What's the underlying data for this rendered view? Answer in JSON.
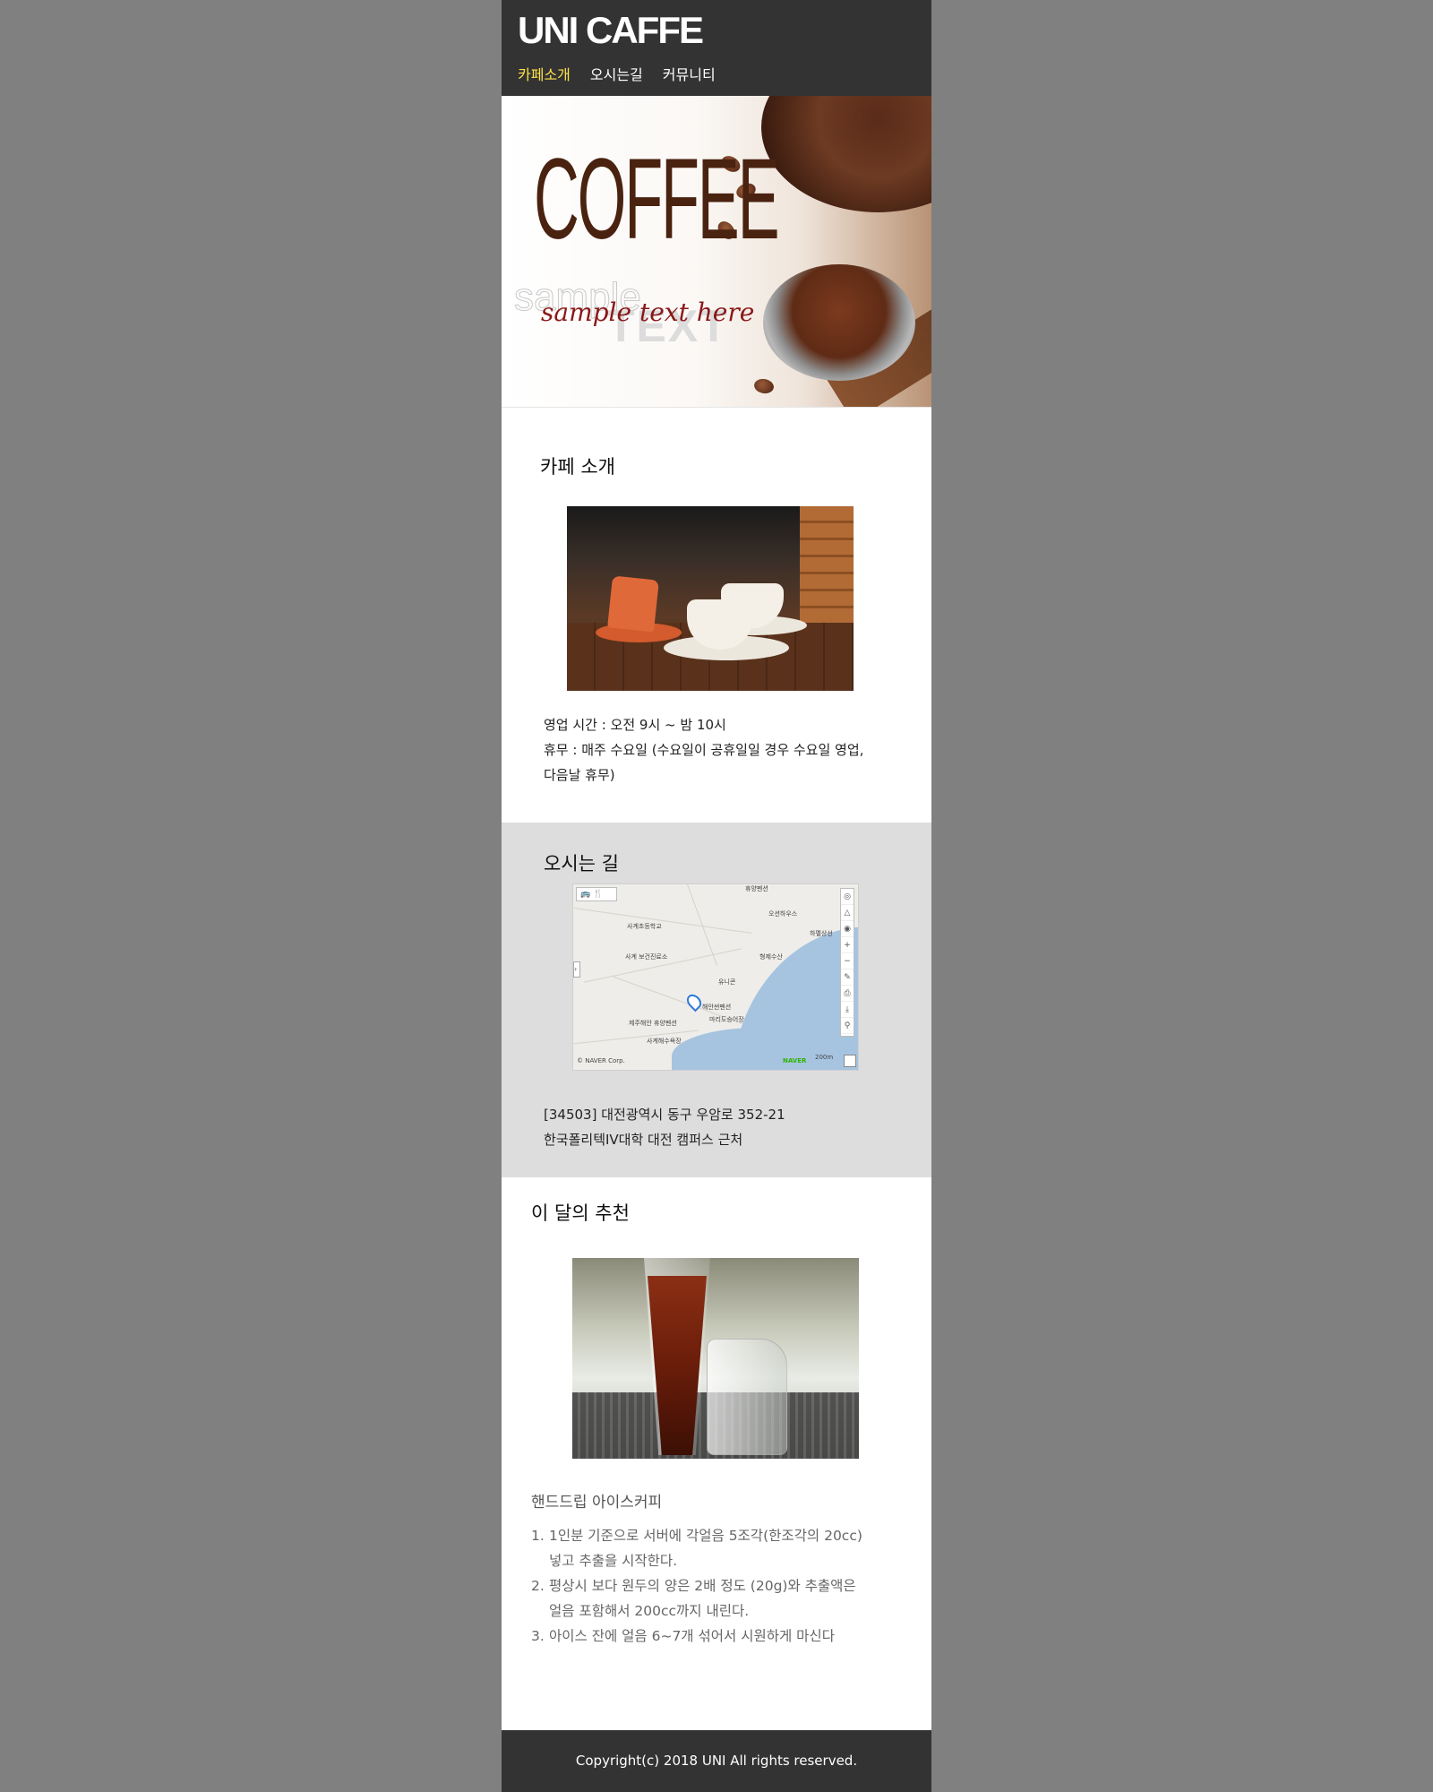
{
  "header": {
    "logo": "UNI CAFFE",
    "nav": [
      "카페소개",
      "오시는길",
      "커뮤니티"
    ]
  },
  "hero": {
    "title": "COFFEE",
    "sample": "sample",
    "script": "sample text here",
    "text_word": "TEXT"
  },
  "intro": {
    "title": "카페 소개",
    "hours": "영업 시간 : 오전 9시 ~ 밤 10시",
    "closed_line1": "휴무 : 매주 수요일 (수요일이 공휴일일 경우 수요일 영업,",
    "closed_line2": "다음날 휴무)"
  },
  "location": {
    "title": "오시는 길",
    "address_line1": "[34503] 대전광역시 동구 우암로 352-21",
    "address_line2": "한국폴리텍IV대학 대전 캠퍼스 근처",
    "map_labels": [
      "사계초등학교",
      "사계 보건진료소",
      "오션하우스",
      "하멜상선",
      "형제수산",
      "유니콘",
      "해안썬펜션",
      "마리도승어장",
      "제주해안 휴양펜션",
      "사계해수욕장",
      "휴양펜션"
    ],
    "map_copyright": "© NAVER Corp.",
    "map_brand": "NAVER",
    "map_scale": "200m"
  },
  "recommend": {
    "title": "이 달의 추천",
    "item_name": "핸드드립 아이스커피",
    "steps": [
      {
        "num": "1.",
        "line1": "1인분 기준으로 서버에 각얼음 5조각(한조각의 20cc)",
        "line2": "넣고 추출을 시작한다."
      },
      {
        "num": "2.",
        "line1": "평상시 보다 원두의 양은 2배 정도 (20g)와 추출액은",
        "line2": "얼음 포함해서 200cc까지 내린다."
      },
      {
        "num": "3.",
        "line1": "아이스 잔에 얼음 6~7개 섞어서 시원하게 마신다",
        "line2": ""
      }
    ]
  },
  "footer": {
    "copyright": "Copyright(c) 2018 UNI All rights reserved."
  },
  "colors": {
    "header_bg": "#333333",
    "nav_active": "#ffe14d",
    "page_bg": "#808080",
    "map_section_bg": "#dddddd"
  }
}
